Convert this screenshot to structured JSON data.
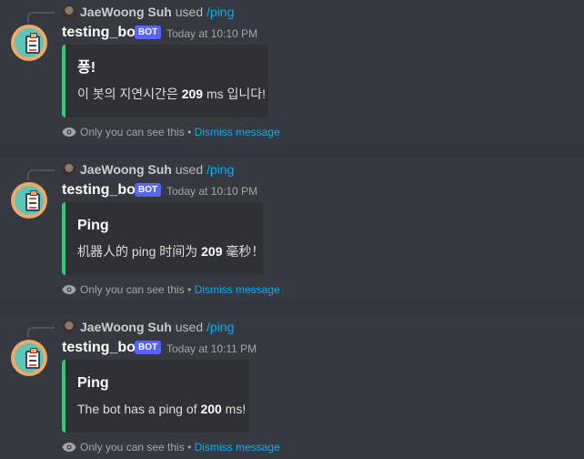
{
  "messages": [
    {
      "reply_user": "JaeWoong Suh",
      "reply_used": "used",
      "reply_command": "/ping",
      "bot_name": "testing_bot",
      "bot_badge": "BOT",
      "timestamp": "Today at 10:10 PM",
      "embed_title": "퐁!",
      "embed_desc_prefix": "이 봇의 지연시간은 ",
      "embed_desc_value": "209",
      "embed_desc_suffix": " ms 입니다!",
      "embed_color": "#2ecc71",
      "ephemeral_text": "Only you can see this",
      "ephemeral_sep": "•",
      "dismiss_label": "Dismiss message"
    },
    {
      "reply_user": "JaeWoong Suh",
      "reply_used": "used",
      "reply_command": "/ping",
      "bot_name": "testing_bot",
      "bot_badge": "BOT",
      "timestamp": "Today at 10:10 PM",
      "embed_title": "Ping",
      "embed_desc_prefix": "机器人的 ping 时间为 ",
      "embed_desc_value": "209",
      "embed_desc_suffix": " 毫秒！",
      "embed_color": "#2ecc71",
      "ephemeral_text": "Only you can see this",
      "ephemeral_sep": "•",
      "dismiss_label": "Dismiss message"
    },
    {
      "reply_user": "JaeWoong Suh",
      "reply_used": "used",
      "reply_command": "/ping",
      "bot_name": "testing_bot",
      "bot_badge": "BOT",
      "timestamp": "Today at 10:11 PM",
      "embed_title": "Ping",
      "embed_desc_prefix": "The bot has a ping of ",
      "embed_desc_value": "200",
      "embed_desc_suffix": " ms!",
      "embed_color": "#2ecc71",
      "ephemeral_text": "Only you can see this",
      "ephemeral_sep": "•",
      "dismiss_label": "Dismiss message"
    }
  ],
  "colors": {
    "background": "#36393f",
    "embed_background": "#2f3136",
    "badge": "#5865f2",
    "link": "#00aff4",
    "embed_accent": "#2ecc71"
  },
  "icons": {
    "bot_avatar": "clipboard-avatar-icon",
    "reply_avatar": "user-avatar-icon",
    "ephemeral": "eye-icon"
  }
}
